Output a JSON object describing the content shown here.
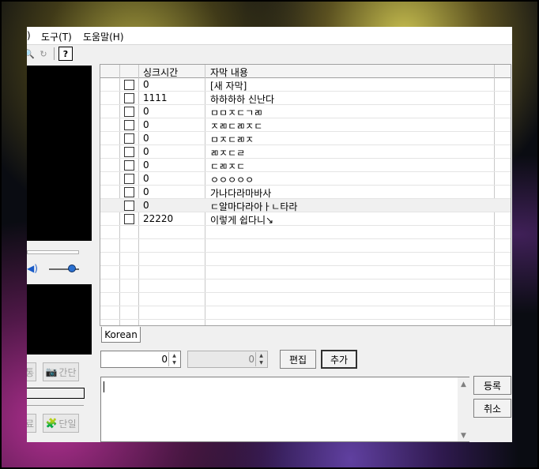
{
  "menu": {
    "partial": ")",
    "tools": "도구(T)",
    "help": "도움말(H)"
  },
  "toolbar": {
    "help_glyph": "?"
  },
  "left_panel": {
    "simple_label": "간단",
    "single_label": "단일"
  },
  "grid": {
    "col_time": "싱크시간",
    "col_text": "자막 내용",
    "rows": [
      {
        "time": "0",
        "text": "[새 자막]"
      },
      {
        "time": "1111",
        "text": "하하하하 신난다"
      },
      {
        "time": "0",
        "text": "ㅁㅁㅈㄷㄱㄻ"
      },
      {
        "time": "0",
        "text": "ㅈㄻㄷㄻㅈㄷ"
      },
      {
        "time": "0",
        "text": "ㅁㅈㄷㄻㅈ"
      },
      {
        "time": "0",
        "text": "ㄻㅈㄷㄹ"
      },
      {
        "time": "0",
        "text": "ㄷㄻㅈㄷ"
      },
      {
        "time": "0",
        "text": "ㅇㅇㅇㅇㅇ"
      },
      {
        "time": "0",
        "text": "가나다라마바사"
      },
      {
        "time": "0",
        "text": "ㄷ알마다라아ㅏㄴ타라"
      },
      {
        "time": "22220",
        "text": "이렇게 쉽다니↘"
      }
    ]
  },
  "tabs": {
    "korean": "Korean"
  },
  "controls": {
    "start_value": "0",
    "end_value": "0",
    "edit_label": "편집",
    "add_label": "추가",
    "register_label": "등록",
    "cancel_label": "취소"
  }
}
